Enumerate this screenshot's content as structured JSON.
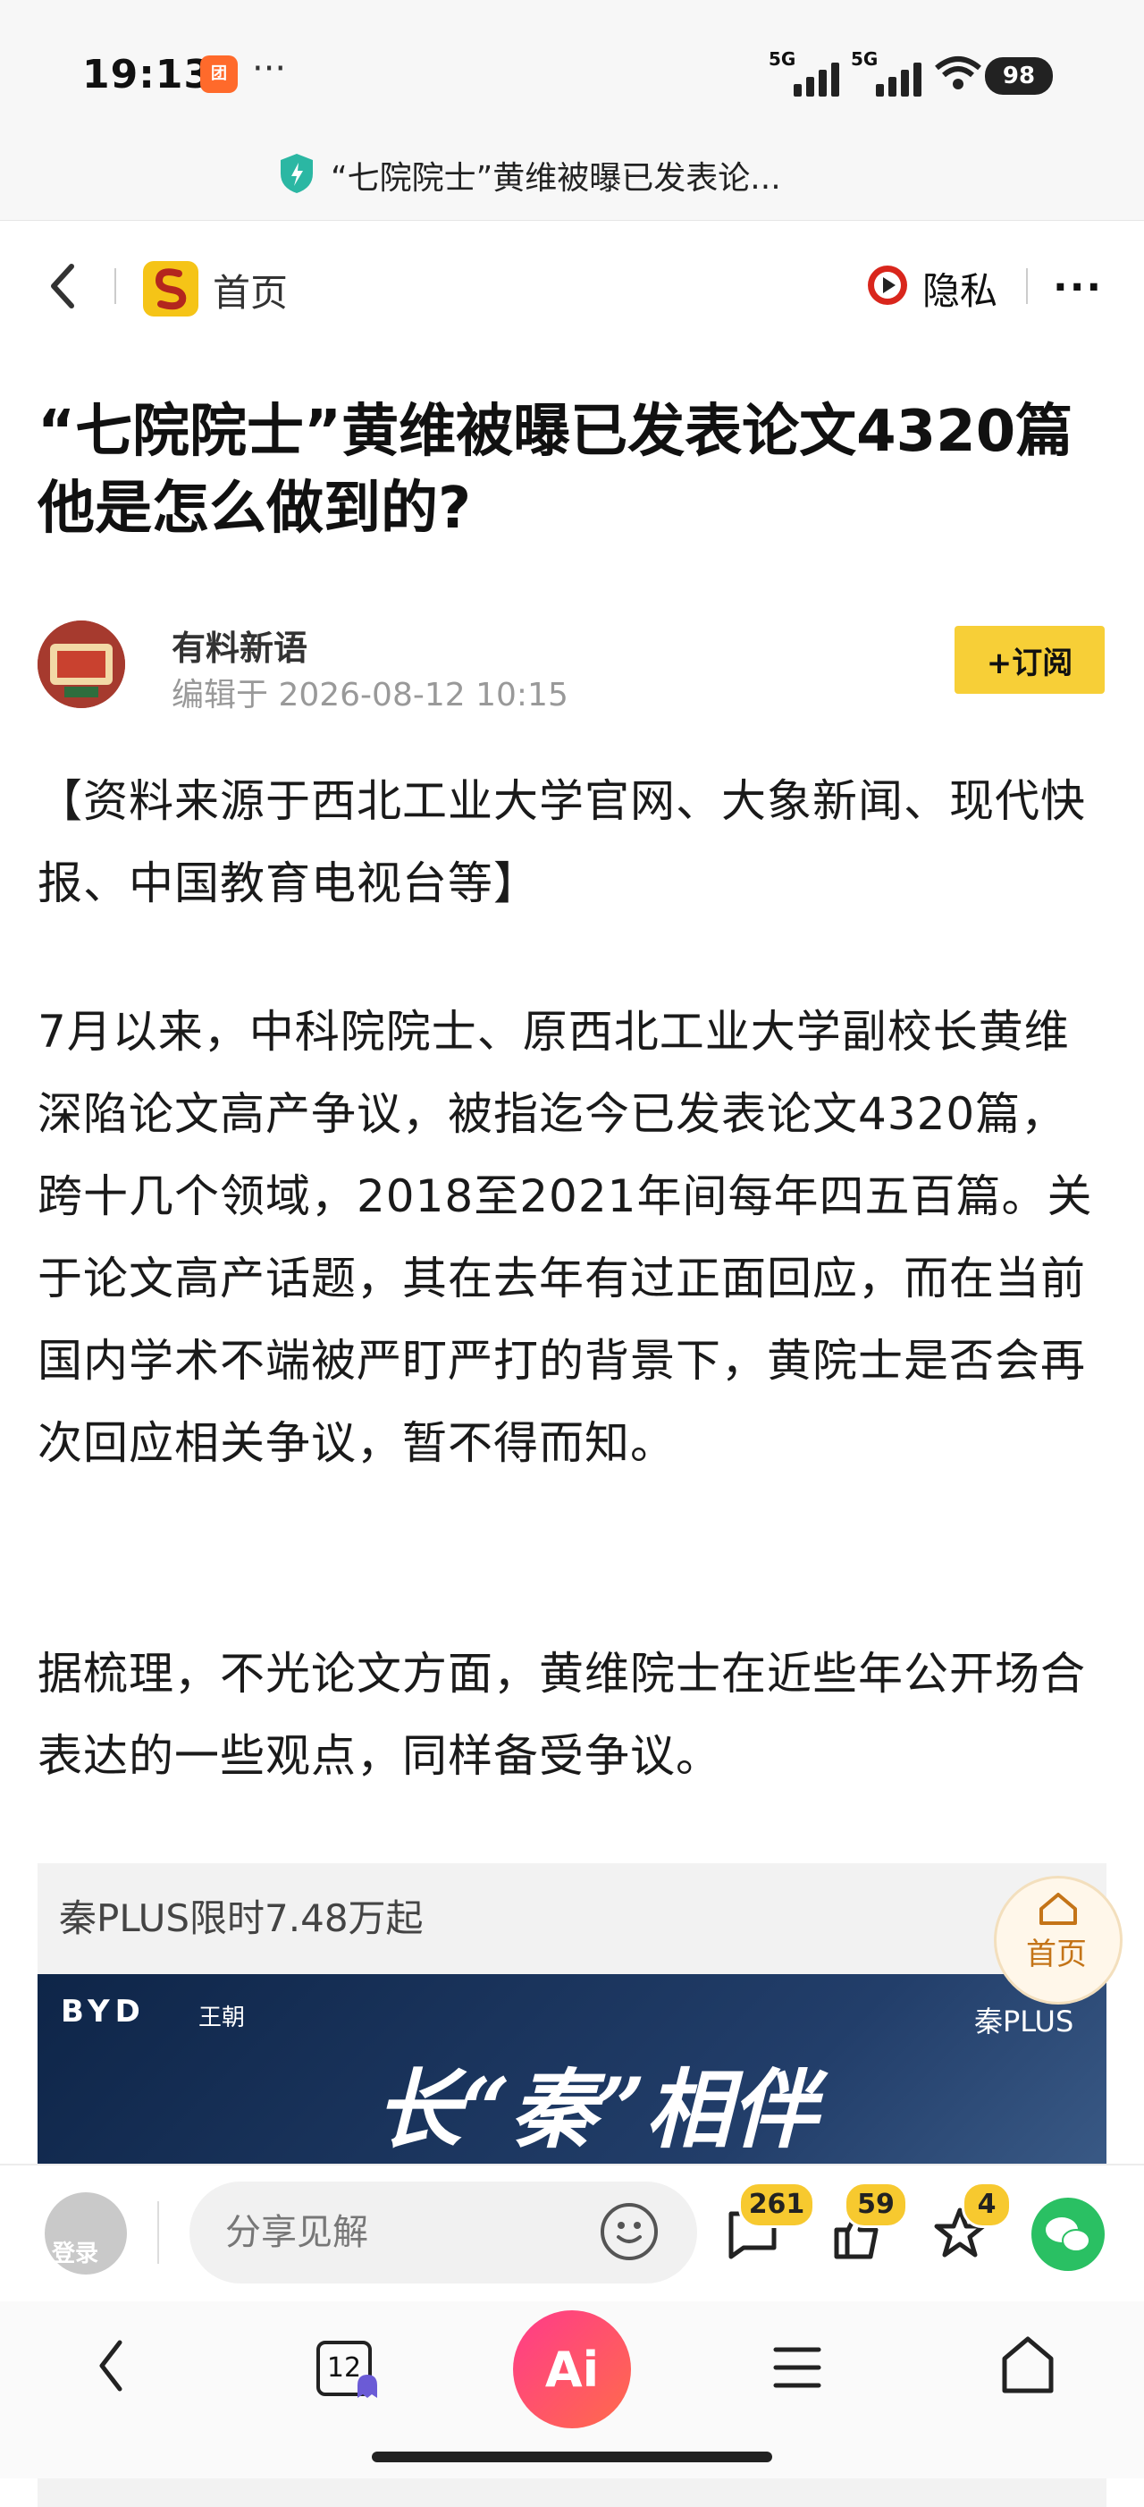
{
  "status_bar": {
    "time": "19:13",
    "app_icon_text": "团",
    "more": "···",
    "network1": "5G",
    "network2": "5G",
    "battery": "98"
  },
  "address_bar": {
    "title": "“七院院士”黄维被曝已发表论..."
  },
  "nav": {
    "home_label": "首页",
    "privacy_label": "隐私",
    "more_label": "···"
  },
  "article": {
    "headline": "“七院院士”黄维被曝已发表论文4320篇 他是怎么做到的?",
    "author": "有料新语",
    "edited": "编辑于 2026-08-12 10:15",
    "subscribe_label": "+订阅",
    "paragraphs": [
      "【资料来源于西北工业大学官网、大象新闻、现代快报、中国教育电视台等】",
      "7月以来，中科院院士、原西北工业大学副校长黄维深陷论文高产争议，被指迄今已发表论文4320篇，跨十几个领域，2018至2021年间每年四五百篇。关于论文高产话题，其在去年有过正面回应，而在当前国内学术不端被严盯严打的背景下，黄院士是否会再次回应相关争议，暂不得而知。",
      "据梳理，不光论文方面，黄维院士在近些年公开场合表达的一些观点，同样备受争议。"
    ]
  },
  "ad": {
    "text": "秦PLUS限时7.48万起",
    "brand": "BYD",
    "brand_sub": "王朝",
    "model": "秦PLUS",
    "slogan": "长“秦”相伴"
  },
  "floating_home": {
    "label": "首页"
  },
  "comment_bar": {
    "login_label": "登录",
    "share_placeholder": "分享见解",
    "comments_count": "261",
    "likes_count": "59",
    "favorites_count": "4"
  },
  "system_nav": {
    "tab_count": "12",
    "ai_label": "Ai"
  },
  "colors": {
    "accent_yellow": "#f7cf37",
    "wechat_green": "#2ac063",
    "ai_pink": "#ff3b8a"
  }
}
